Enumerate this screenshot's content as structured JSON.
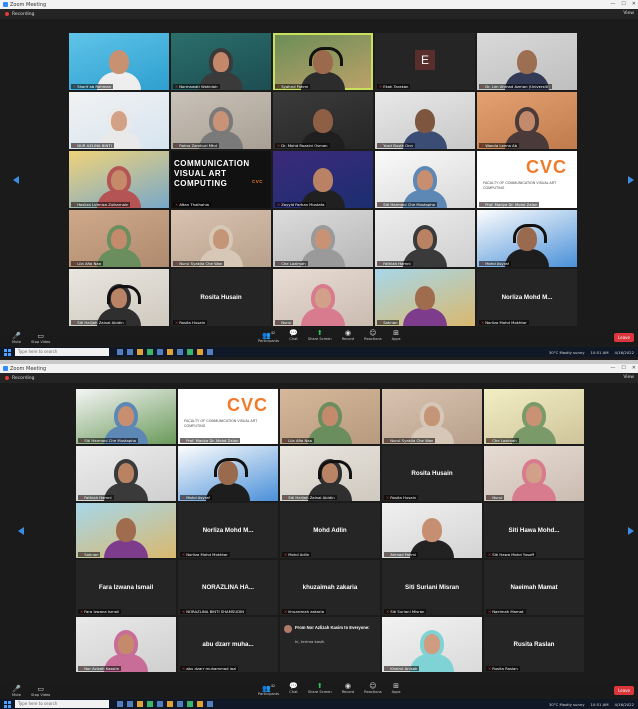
{
  "window": {
    "title": "Zoom Meeting",
    "recording_label": "Recording",
    "view_label": "View",
    "ctrl_min": "—",
    "ctrl_max": "☐",
    "ctrl_close": "✕"
  },
  "toolbar": {
    "mute": "Mute",
    "stop_video": "Stop Video",
    "participants": "Participants",
    "participants_count": "42",
    "chat": "Chat",
    "share_screen": "Share Screen",
    "record": "Record",
    "reactions": "Reactions",
    "apps": "Apps",
    "leave": "Leave"
  },
  "taskbar": {
    "search_placeholder": "Type here to search",
    "weather": "30°C  Mostly sunny",
    "time": "10:51 AM",
    "date": "4/16/2022"
  },
  "grid1": [
    {
      "kind": "video",
      "c1": "#5fc4e8",
      "c2": "#2e9fd0",
      "skin": "#c89272",
      "shirt": "#eeeeee",
      "name": "Sharif ab Rahman",
      "active": false
    },
    {
      "kind": "video",
      "c1": "#2a6f6a",
      "c2": "#1d4d52",
      "skin": "#c4876a",
      "shirt": "#2d2d2d",
      "hijab": true,
      "scarf": "#3a3a3a",
      "name": "Normawati Wahidah",
      "active": false
    },
    {
      "kind": "video",
      "c1": "#6a8d56",
      "c2": "#bda26a",
      "skin": "#9b6a4c",
      "shirt": "#2c2c2c",
      "headset": true,
      "name": "Syahrul Fahmi",
      "active": true
    },
    {
      "kind": "avatar",
      "letter": "E",
      "name": "Ekah Tarakan",
      "active": false
    },
    {
      "kind": "video",
      "c1": "#d9d9d9",
      "c2": "#bfbfbf",
      "skin": "#9c6e52",
      "shirt": "#333a55",
      "name": "Dr. Lim Ahmad Azman (Universiti)",
      "active": false
    },
    {
      "kind": "video",
      "c1": "#f2f2f2",
      "c2": "#d6e4f0",
      "skin": "#d3a186",
      "shirt": "#e6e6e6",
      "hijab": true,
      "scarf": "#e9e9e9",
      "name": "NUR AZLINA BINTI",
      "active": false
    },
    {
      "kind": "video",
      "c1": "#c9c2b8",
      "c2": "#a99f94",
      "skin": "#c89376",
      "shirt": "#5a5a5a",
      "hijab": true,
      "scarf": "#7a7a7a",
      "name": "Ratna Zamhuri Mhd",
      "active": false
    },
    {
      "kind": "video",
      "c1": "#3b3b3b",
      "c2": "#262626",
      "skin": "#8e5f44",
      "shirt": "#1f1f1f",
      "name": "Dr. Mohd Rozaini Osman",
      "active": false
    },
    {
      "kind": "video",
      "c1": "#e8e8e8",
      "c2": "#c8c8c8",
      "skin": "#7e5640",
      "shirt": "#3b4d74",
      "name": "Yusri Bustk Onn",
      "active": false
    },
    {
      "kind": "video",
      "c1": "#e4a171",
      "c2": "#c07b4d",
      "skin": "#c28a6b",
      "shirt": "#3a2f2f",
      "hijab": true,
      "scarf": "#4a3a3a",
      "name": "Wanda Lanna Ab",
      "active": false
    },
    {
      "kind": "video",
      "c1": "#f0d37a",
      "c2": "#77a8c9",
      "skin": "#c58a6a",
      "shirt": "#aa4444",
      "hijab": true,
      "scarf": "#b45454",
      "name": "Hasliza Lutmiza Zulkarnain",
      "active": false
    },
    {
      "kind": "comm",
      "text": "COMMUNICATION VISUAL ART COMPUTING",
      "mini": "CVC",
      "name": "Aftan Thalhahia",
      "active": false
    },
    {
      "kind": "video",
      "c1": "#3c2a7a",
      "c2": "#1b2e70",
      "skin": "#b98264",
      "shirt": "#202020",
      "name": "Zayyid Farhan Mustafa",
      "active": false
    },
    {
      "kind": "video",
      "c1": "#fafafa",
      "c2": "#d8d8d8",
      "skin": "#c88e70",
      "shirt": "#3b6fa0",
      "hijab": true,
      "scarf": "#5d88b5",
      "name": "Siti Harmani Che Mustapha",
      "active": false
    },
    {
      "kind": "slide",
      "logo": "CVC",
      "sub": "FACULTY OF COMMUNICATION VISUAL ART COMPUTING",
      "name": "Prof. Madya Dr. Mohd Zalan",
      "active": false
    },
    {
      "kind": "video",
      "c1": "#cfa98a",
      "c2": "#b08a6e",
      "skin": "#c48a6c",
      "shirt": "#5a7a52",
      "hijab": true,
      "scarf": "#6b8e5e",
      "name": "Lila Afia Naa",
      "active": false
    },
    {
      "kind": "video",
      "c1": "#d9c3b0",
      "c2": "#b8a08c",
      "skin": "#c59578",
      "shirt": "#d2c2b0",
      "hijab": true,
      "scarf": "#d6c7b6",
      "name": "Nurul Syakila Che Wan",
      "active": false
    },
    {
      "kind": "video",
      "c1": "#dcdcdc",
      "c2": "#b7b7b7",
      "skin": "#c99275",
      "shirt": "#e4e4e4",
      "hijab": true,
      "scarf": "#9a9a9a",
      "name": "Che Lazimah",
      "active": false
    },
    {
      "kind": "video",
      "c1": "#ededed",
      "c2": "#cfcfcf",
      "skin": "#b98263",
      "shirt": "#2c2c2c",
      "hijab": true,
      "scarf": "#3a3a3a",
      "name": "Fathiah Hamni",
      "active": false
    },
    {
      "kind": "video",
      "c1": "#fdfdfd",
      "c2": "#4a90d9",
      "skin": "#9a6a4e",
      "shirt": "#1d1d1d",
      "headset": true,
      "name": "Mohd Asyraf",
      "active": false
    },
    {
      "kind": "video",
      "c1": "#e9e6e0",
      "c2": "#cfc9bf",
      "skin": "#b98466",
      "shirt": "#3f3f3f",
      "headset": true,
      "hijab": true,
      "scarf": "#2f2f2f",
      "name": "Siti Halijah Zainal Abidin",
      "active": false
    },
    {
      "kind": "name",
      "big": "Rosita Husain",
      "name": "Rosita Husain",
      "active": false
    },
    {
      "kind": "video",
      "c1": "#e7dcd4",
      "c2": "#cbbcb1",
      "skin": "#d2a088",
      "shirt": "#c55a6a",
      "hijab": true,
      "scarf": "#d87b8e",
      "name": "Nurul",
      "active": false
    },
    {
      "kind": "video",
      "c1": "#a7d7e9",
      "c2": "#d9b86e",
      "skin": "#9f6c4e",
      "shirt": "#7d3d8c",
      "name": "Sahnan",
      "active": false
    },
    {
      "kind": "name",
      "big": "Norliza Mohd M...",
      "name": "Norliza Mohd Mokhtar",
      "active": false
    }
  ],
  "grid2": [
    {
      "kind": "video",
      "c1": "#f5f5f5",
      "c2": "#6a9a5a",
      "skin": "#c88e70",
      "shirt": "#3b6fa0",
      "hijab": true,
      "scarf": "#5d88b5",
      "name": "Siti Harmani Che Mustapha",
      "active": false
    },
    {
      "kind": "slide",
      "logo": "CVC",
      "sub": "FACULTY OF COMMUNICATION VISUAL ART COMPUTING",
      "name": "Prof. Madya Dr. Mohd Zalan",
      "active": false
    },
    {
      "kind": "video",
      "c1": "#d5b79a",
      "c2": "#b89a7e",
      "skin": "#c48a6c",
      "shirt": "#5a7a52",
      "hijab": true,
      "scarf": "#6b8e5e",
      "name": "Lila Afia Naa",
      "active": false
    },
    {
      "kind": "video",
      "c1": "#d9c3b0",
      "c2": "#b8a08c",
      "skin": "#c59578",
      "shirt": "#d2c2b0",
      "hijab": true,
      "scarf": "#d6c7b6",
      "name": "Nurul Syakila Che Wan",
      "active": false
    },
    {
      "kind": "video",
      "c1": "#f2eec4",
      "c2": "#cfc49a",
      "skin": "#c99275",
      "shirt": "#6a8c5a",
      "hijab": true,
      "scarf": "#7a9a6a",
      "name": "Che Lazimah",
      "active": false
    },
    {
      "kind": "video",
      "c1": "#ededed",
      "c2": "#cfcfcf",
      "skin": "#b98263",
      "shirt": "#2c2c2c",
      "hijab": true,
      "scarf": "#3a3a3a",
      "name": "Fathiah Hamni",
      "active": false
    },
    {
      "kind": "video",
      "c1": "#fdfdfd",
      "c2": "#4a90d9",
      "skin": "#9a6a4e",
      "shirt": "#1d1d1d",
      "headset": true,
      "name": "Mohd Asyraf",
      "active": false
    },
    {
      "kind": "video",
      "c1": "#e9e6e0",
      "c2": "#cfc9bf",
      "skin": "#b98466",
      "shirt": "#3f3f3f",
      "headset": true,
      "hijab": true,
      "scarf": "#2f2f2f",
      "name": "Siti Halijah Zainal Abidin",
      "active": false
    },
    {
      "kind": "name",
      "big": "Rosita Husain",
      "name": "Rosita Husain",
      "active": false
    },
    {
      "kind": "video",
      "c1": "#e7dcd4",
      "c2": "#cbbcb1",
      "skin": "#d2a088",
      "shirt": "#c55a6a",
      "hijab": true,
      "scarf": "#d87b8e",
      "name": "Nurul",
      "active": false
    },
    {
      "kind": "video",
      "c1": "#a7d7e9",
      "c2": "#d9b86e",
      "skin": "#9f6c4e",
      "shirt": "#7d3d8c",
      "name": "Sahnan",
      "active": false
    },
    {
      "kind": "name",
      "big": "Norliza Mohd M...",
      "name": "Norliza Mohd Mokhtar",
      "active": false
    },
    {
      "kind": "name",
      "big": "Mohd Adlin",
      "name": "Mohd Adlin",
      "active": false
    },
    {
      "kind": "video",
      "c1": "#f0f0f0",
      "c2": "#d4d4d4",
      "skin": "#c68f72",
      "shirt": "#222222",
      "name": "Ahmad Fahmi",
      "active": false
    },
    {
      "kind": "name",
      "big": "Siti Hawa Mohd...",
      "name": "Siti Hawa Mohd Yusoff",
      "active": false
    },
    {
      "kind": "name",
      "big": "Fara Izwana Ismail",
      "name": "Fara Izwana Ismail",
      "active": false
    },
    {
      "kind": "name",
      "big": "NORAZLINA HA...",
      "name": "NORAZLINA BINTI SHAMSUDIN",
      "active": false
    },
    {
      "kind": "name",
      "big": "khuzaimah zakaria",
      "name": "khuzaimah zakaria",
      "active": false
    },
    {
      "kind": "name",
      "big": "Siti Suriani Misran",
      "name": "Siti Suriani Misran",
      "active": false
    },
    {
      "kind": "name",
      "big": "Naeimah Mamat",
      "name": "Naeimah Mamat",
      "active": false
    },
    {
      "kind": "video",
      "c1": "#e9e9e9",
      "c2": "#cfcfcf",
      "skin": "#c5896b",
      "shirt": "#b75f86",
      "hijab": true,
      "scarf": "#c86d98",
      "name": "Nor Azizah Kassim",
      "active": false
    },
    {
      "kind": "name",
      "big": "abu dzarr muha...",
      "name": "abu dzarr muhammad lazi",
      "active": false
    },
    {
      "kind": "chat",
      "from": "From Nor Azlizah Kasim to Everyone:",
      "msg": "hi, terima kasih",
      "name": "",
      "active": false
    },
    {
      "kind": "video",
      "c1": "#f2f2f2",
      "c2": "#dadada",
      "skin": "#cf9c80",
      "shirt": "#6ec6c8",
      "hijab": true,
      "scarf": "#7fd3d5",
      "name": "Khairul Anisah",
      "active": false
    },
    {
      "kind": "name",
      "big": "Rusita Raslan",
      "name": "Rusita Raslan",
      "active": false
    }
  ]
}
